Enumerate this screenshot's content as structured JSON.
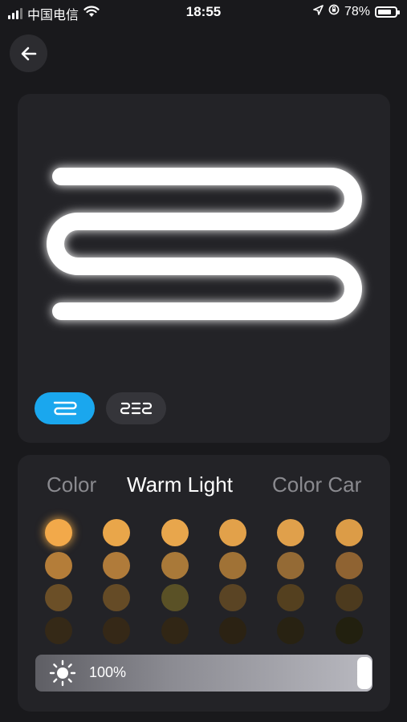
{
  "status_bar": {
    "carrier": "中国电信",
    "time": "18:55",
    "battery_percent": "78%",
    "battery_level": 0.78,
    "icons": [
      "signal-icon",
      "wifi-icon",
      "location-arrow-icon",
      "orientation-lock-icon",
      "battery-icon"
    ]
  },
  "nav": {
    "back_icon": "arrow-left-icon"
  },
  "preview": {
    "modes": [
      {
        "icon": "single-strip-icon",
        "active": true,
        "color": "#1aa7ee"
      },
      {
        "icon": "split-strip-icon",
        "active": false,
        "color": "#35353a"
      }
    ]
  },
  "color_panel": {
    "tabs": [
      {
        "label": "Color",
        "active": false
      },
      {
        "label": "Warm Light",
        "active": true
      },
      {
        "label": "Color Car",
        "active": false
      }
    ],
    "swatches": [
      [
        "#f2a94a",
        "#e9a64a",
        "#e8a64c",
        "#e2a14a",
        "#e0a04b",
        "#dc9c47"
      ],
      [
        "#b47d39",
        "#b07b3a",
        "#a97939",
        "#a07236",
        "#946a35",
        "#8f6332"
      ],
      [
        "#6b4f27",
        "#654b26",
        "#5a5126",
        "#5a4424",
        "#54401f",
        "#4c3a1e"
      ],
      [
        "#352917",
        "#352817",
        "#312615",
        "#2b2213",
        "#282212",
        "#22200f"
      ]
    ],
    "selected_swatch": [
      0,
      0
    ],
    "brightness": {
      "label": "100%",
      "value": 1.0,
      "icon": "sun-icon"
    }
  }
}
